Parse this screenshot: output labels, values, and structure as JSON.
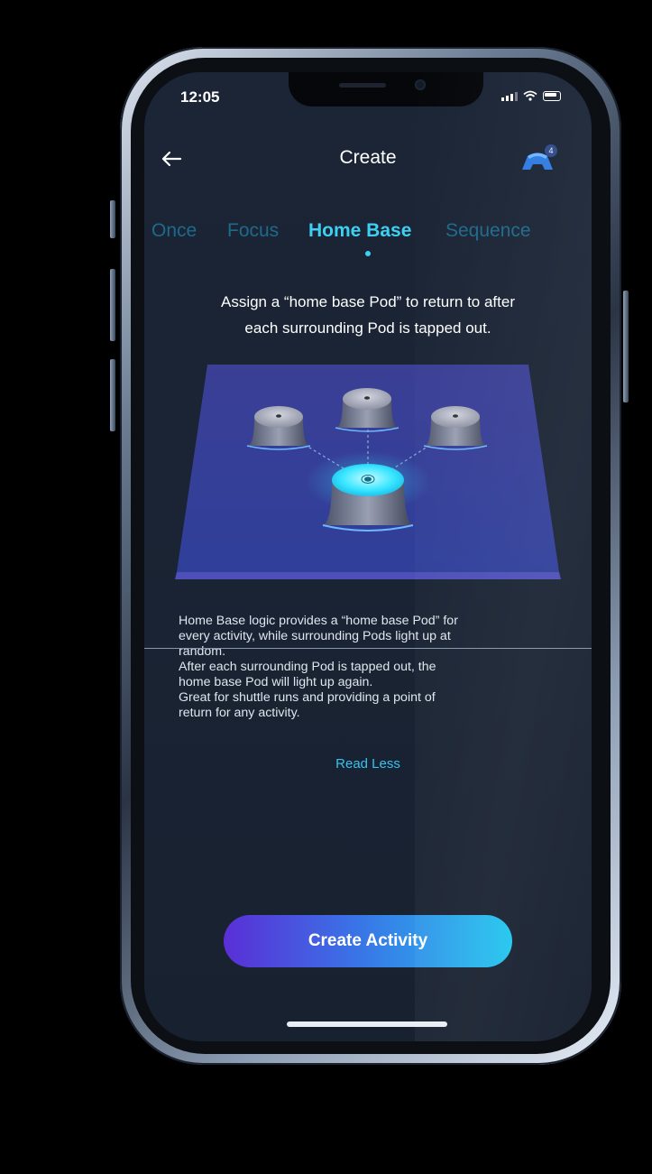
{
  "status_bar": {
    "time": "12:05"
  },
  "header": {
    "title": "Create",
    "device_count": "4"
  },
  "tabs": [
    {
      "label": "Once",
      "active": false
    },
    {
      "label": "Focus",
      "active": false
    },
    {
      "label": "Home Base",
      "active": true
    },
    {
      "label": "Sequence",
      "active": false
    }
  ],
  "headline": {
    "line1": "Assign a “home base Pod” to return to after",
    "line2": "each surrounding Pod is tapped out."
  },
  "description": {
    "lines": [
      "Home Base logic provides a “home base Pod” for",
      "every activity, while surrounding Pods light up at",
      "random.",
      "After each surrounding Pod is tapped out, the",
      "home base Pod will light up again.",
      "Great for shuttle runs and providing a point of",
      "return for any activity."
    ],
    "read_less": "Read Less"
  },
  "cta": {
    "label": "Create Activity"
  },
  "colors": {
    "accent": "#3ed0f2",
    "inactive_tab": "#1e6a8a",
    "background": "#1b2536",
    "cta_start": "#5a2fd6",
    "cta_end": "#22c6ee"
  }
}
